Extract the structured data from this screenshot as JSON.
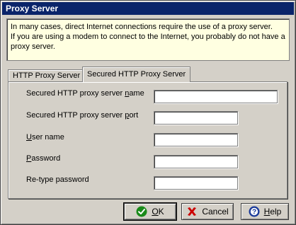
{
  "window": {
    "title": "Proxy Server"
  },
  "info": {
    "lines": [
      "In many cases, direct Internet connections require the use of a proxy server.",
      "If you are using a modem to connect to the Internet, you probably do not have a",
      "proxy server."
    ]
  },
  "tabs": [
    {
      "label": "HTTP Proxy Server",
      "active": false
    },
    {
      "label": "Secured HTTP Proxy Server",
      "active": true
    }
  ],
  "fields": {
    "server_name": {
      "label_pre": "Secured HTTP proxy server ",
      "label_u": "n",
      "label_post": "ame",
      "value": ""
    },
    "server_port": {
      "label_pre": "Secured HTTP proxy server ",
      "label_u": "p",
      "label_post": "ort",
      "value": ""
    },
    "user_name": {
      "label_pre": "",
      "label_u": "U",
      "label_post": "ser name",
      "value": ""
    },
    "password": {
      "label_pre": "",
      "label_u": "P",
      "label_post": "assword",
      "value": ""
    },
    "retype_password": {
      "label_pre": "Re-type password",
      "label_u": "",
      "label_post": "",
      "value": ""
    }
  },
  "buttons": {
    "ok": {
      "label_u": "O",
      "label_post": "K",
      "icon": "check-icon",
      "color": "#1a8a1a"
    },
    "cancel": {
      "label": "Cancel",
      "icon": "x-icon",
      "color": "#cc0000"
    },
    "help": {
      "label_u": "H",
      "label_post": "elp",
      "icon": "help-icon",
      "color": "#1a3a9a"
    }
  }
}
